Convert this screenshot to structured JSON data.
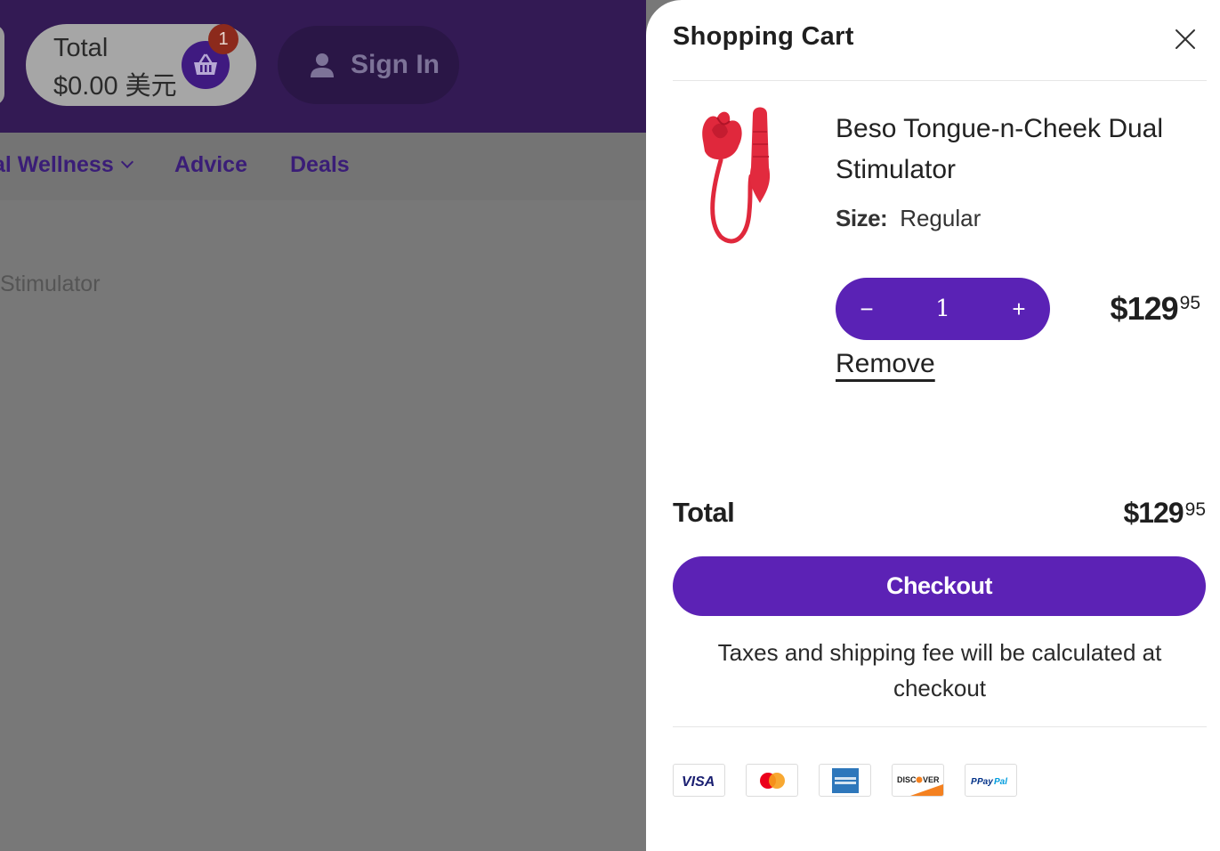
{
  "header": {
    "cart_total_label": "Total",
    "cart_total_value": "$0.00 美元",
    "cart_badge_count": "1",
    "sign_in_label": "Sign In"
  },
  "nav": {
    "items": [
      "al Wellness",
      "Advice",
      "Deals"
    ]
  },
  "background_page": {
    "breadcrumb_text": "Stimulator"
  },
  "drawer": {
    "title": "Shopping Cart",
    "item": {
      "name": "Beso Tongue-n-Cheek Dual Stimulator",
      "size_label": "Size:",
      "size_value": "Regular",
      "quantity": "1",
      "minus_glyph": "−",
      "plus_glyph": "+",
      "price_dollars": "$129",
      "price_cents": "95",
      "remove_label": "Remove"
    },
    "total_label": "Total",
    "total_dollars": "$129",
    "total_cents": "95",
    "checkout_label": "Checkout",
    "tax_note": "Taxes and shipping fee will be calculated at checkout",
    "payment_methods": [
      "visa",
      "mastercard",
      "american-express",
      "discover",
      "paypal"
    ]
  },
  "colors": {
    "brand_purple": "#5c22b5",
    "header_dark": "#331a54",
    "overlay_gray": "#787878"
  }
}
